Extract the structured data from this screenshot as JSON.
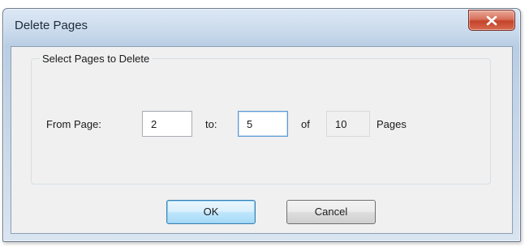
{
  "window": {
    "title": "Delete Pages",
    "close_icon": "close-x-icon"
  },
  "group": {
    "title": "Select Pages to Delete"
  },
  "range": {
    "from_label": "From Page:",
    "from_value": "2",
    "to_label": "to:",
    "to_value": "5",
    "of_label": "of",
    "total_value": "10",
    "pages_label": "Pages"
  },
  "buttons": {
    "ok_label": "OK",
    "cancel_label": "Cancel"
  },
  "colors": {
    "close_button": "#c4432b",
    "focus_border": "#5d9bd5",
    "default_button_border": "#3c7fb1"
  }
}
